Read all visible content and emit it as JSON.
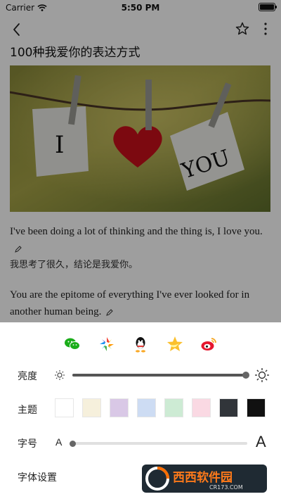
{
  "status_bar": {
    "carrier": "Carrier",
    "time": "5:50 PM"
  },
  "nav": {
    "back_icon": "chevron-left-icon",
    "favorite_icon": "star-outline-icon",
    "more_icon": "more-vertical-icon"
  },
  "article": {
    "title": "100种我爱你的表达方式",
    "hero_words": [
      "I",
      "YOU"
    ],
    "entries": [
      {
        "en": "I've been doing a lot of thinking and the thing is, I love you.",
        "cn": "我思考了很久，结论是我爱你。"
      },
      {
        "en": "You are the epitome of everything I've ever looked for in another human being.",
        "cn": ""
      }
    ]
  },
  "sheet": {
    "share_icons": [
      "wechat-icon",
      "moments-icon",
      "qq-icon",
      "qzone-icon",
      "weibo-icon"
    ],
    "brightness": {
      "label": "亮度",
      "value": 1.0
    },
    "theme": {
      "label": "主题",
      "colors": [
        "#ffffff",
        "#f6f0dc",
        "#d9c8e6",
        "#cddcf3",
        "#cdebd4",
        "#fad9e3",
        "#31353a",
        "#111111"
      ]
    },
    "font_size": {
      "label": "字号",
      "small_glyph": "A",
      "large_glyph": "A",
      "value": 0.0
    },
    "font_settings": {
      "label": "字体设置"
    }
  },
  "watermark": {
    "brand": "西西软件园",
    "domain": "CR173.COM"
  }
}
